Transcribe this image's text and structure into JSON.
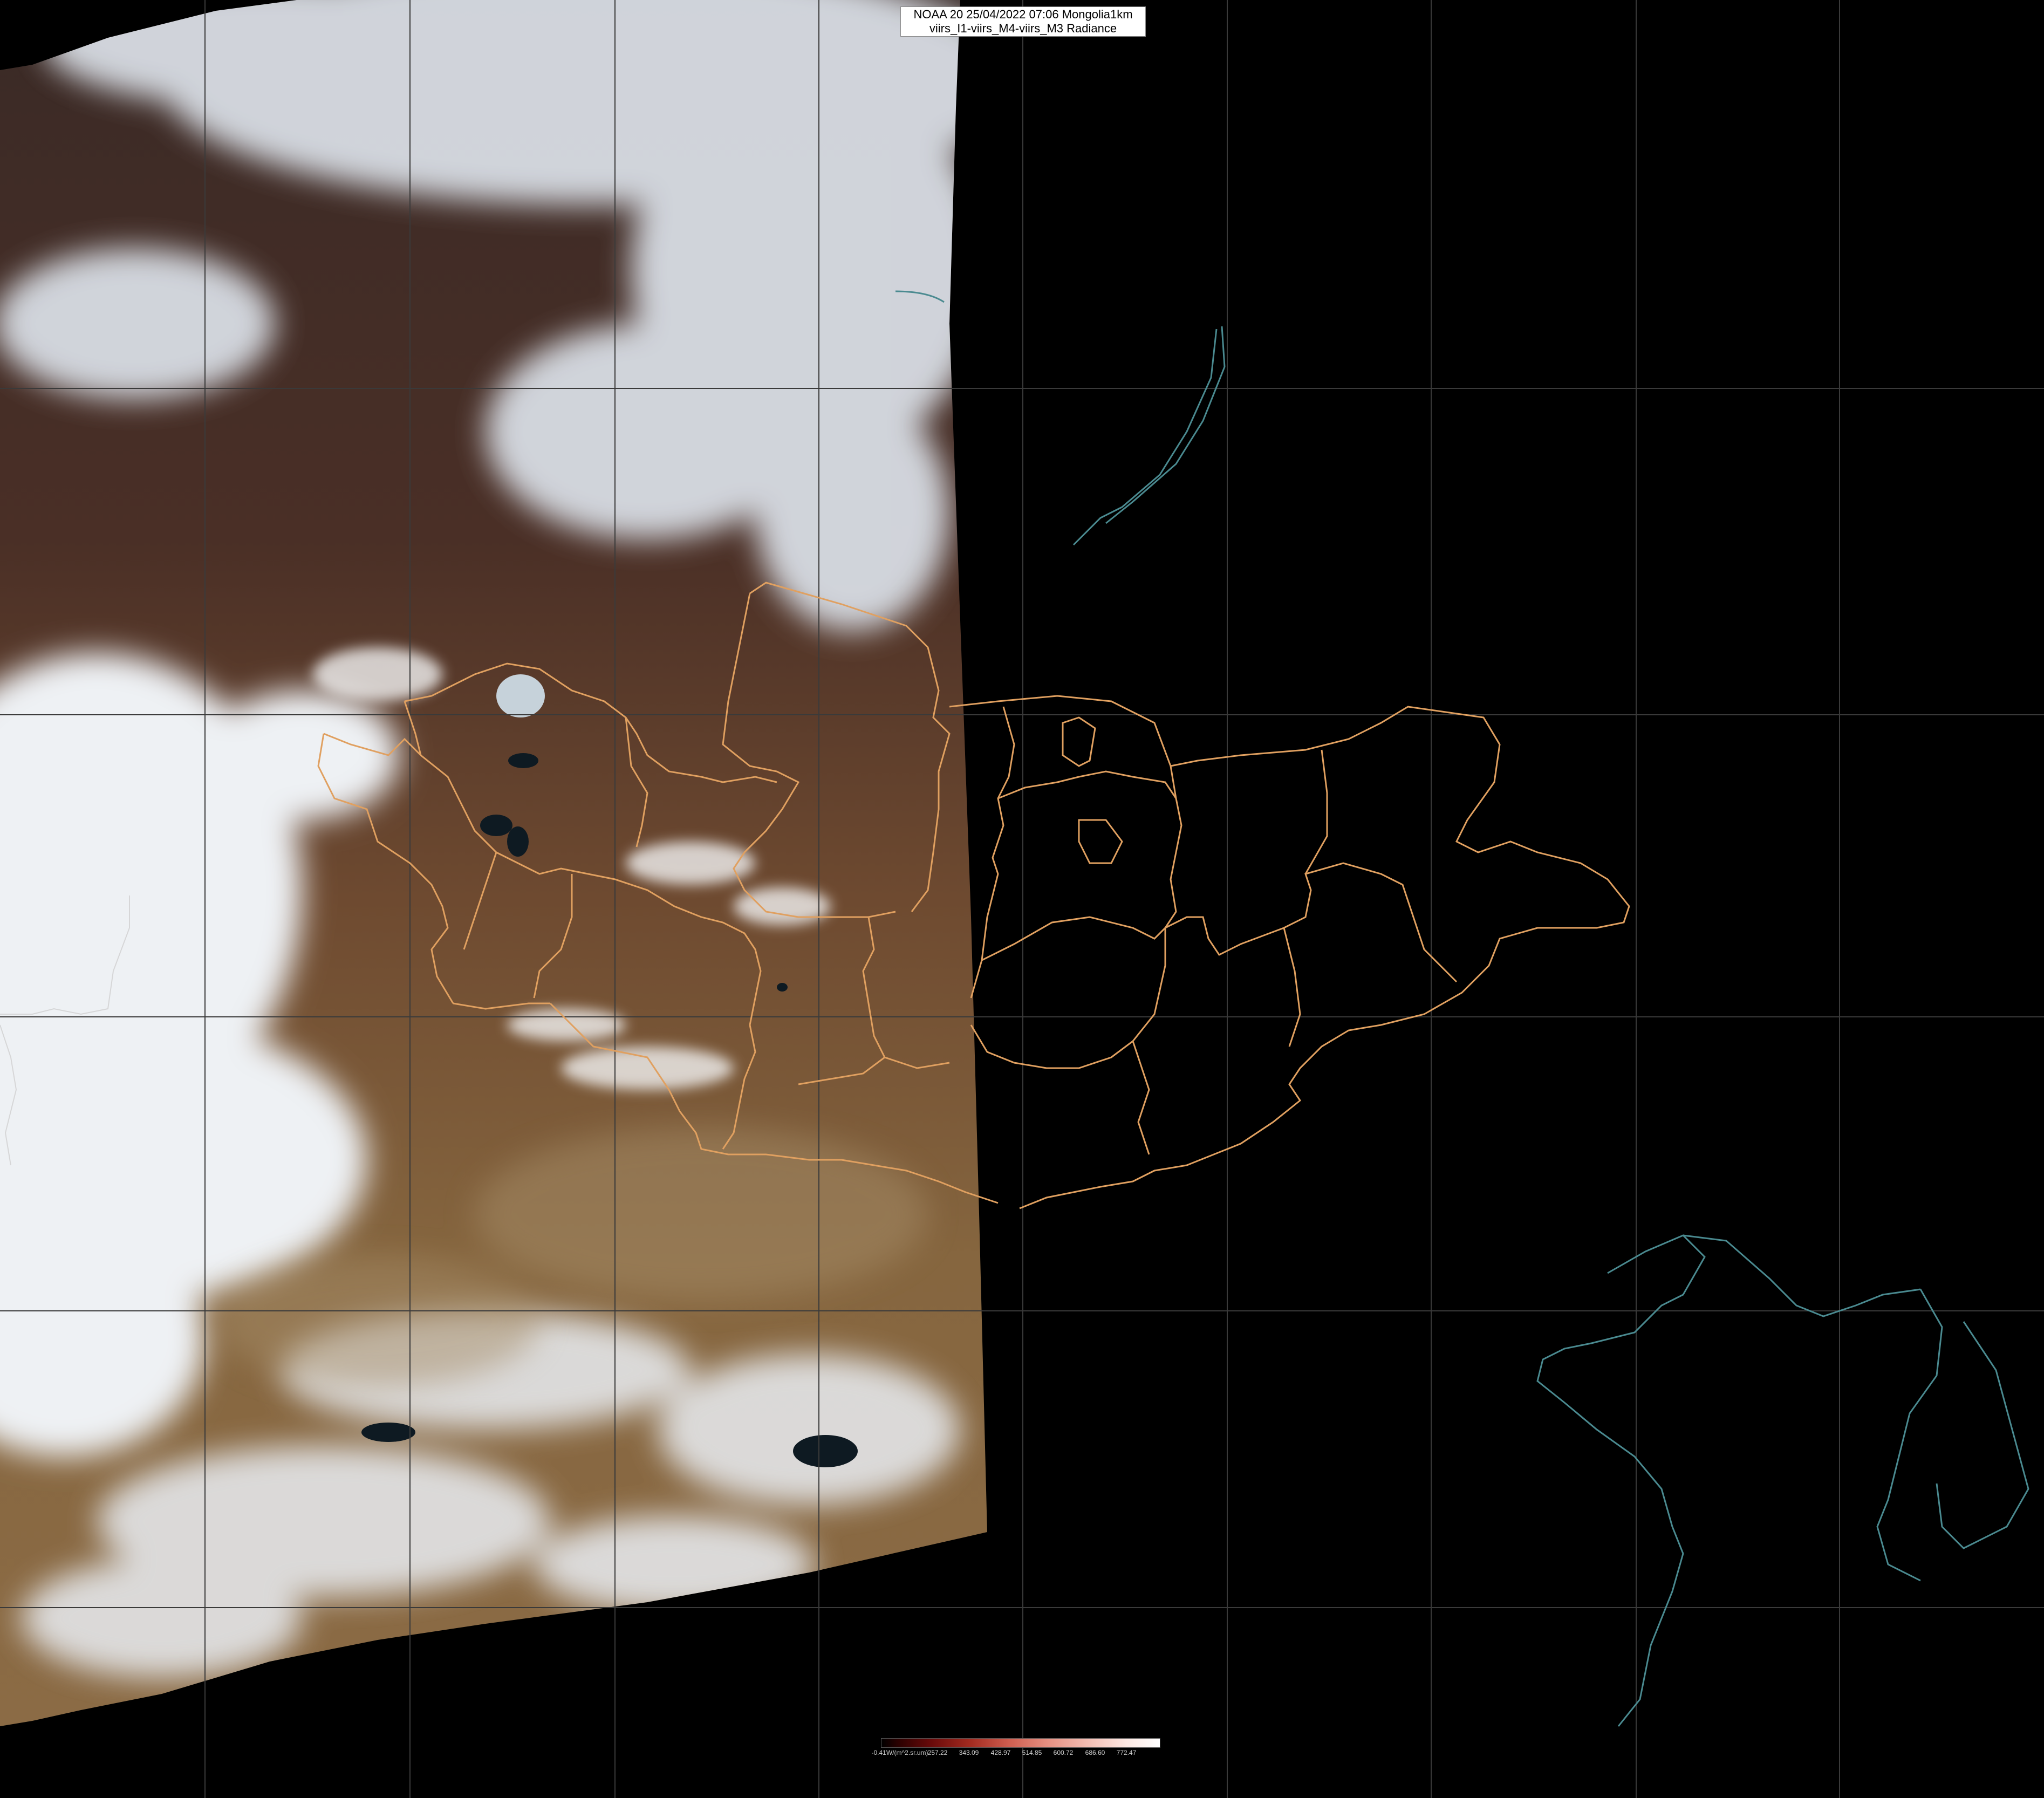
{
  "header": {
    "line1": "NOAA 20 25/04/2022 07:06 Mongolia1km",
    "line2": "viirs_I1-viirs_M4-viirs_M3 Radiance"
  },
  "legend": {
    "ticks": [
      "-0.41W/(m^2.sr.um)",
      "257.22",
      "343.09",
      "428.97",
      "514.85",
      "600.72",
      "686.60",
      "772.47"
    ]
  },
  "colors": {
    "background": "#000000",
    "province_borders": "#e0a060",
    "coastlines": "#4a8a90",
    "graticule": "#3a3a3a"
  }
}
